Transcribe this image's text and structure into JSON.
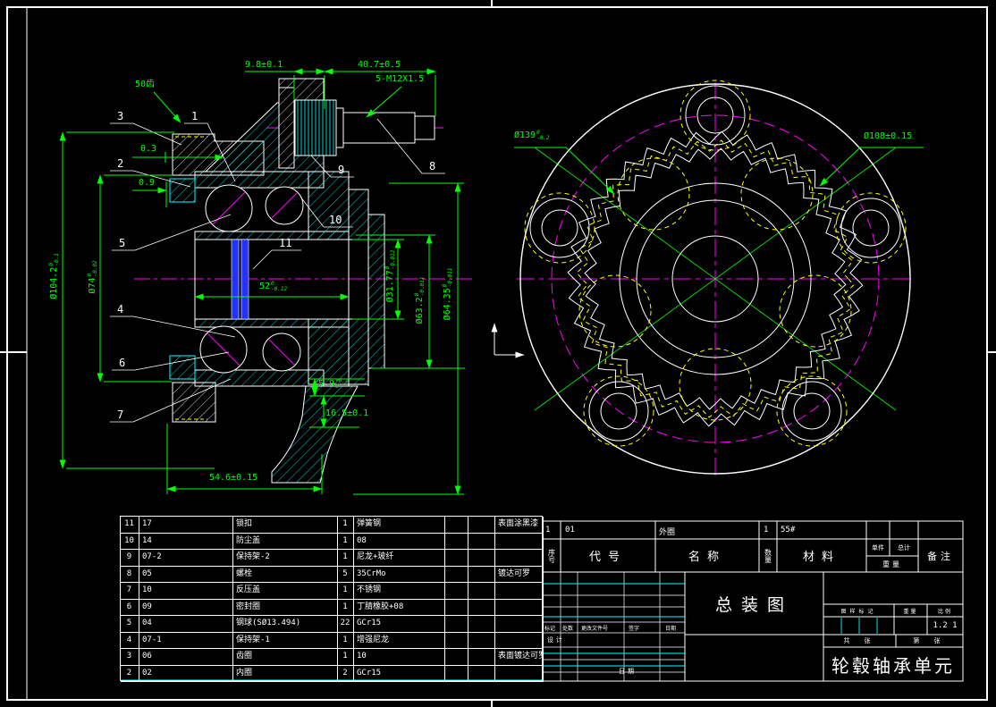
{
  "left_view": {
    "teeth_label": "50齿",
    "balloons": [
      "1",
      "2",
      "3",
      "4",
      "5",
      "6",
      "7",
      "8",
      "9",
      "10",
      "11"
    ],
    "dims": {
      "top_a": {
        "main": "9.8±0.1"
      },
      "top_b": {
        "main": "40.7±0.5"
      },
      "thread": {
        "main": "5-M12X1.5"
      },
      "edge_a": {
        "main": "0.3"
      },
      "edge_b": {
        "main": "0.9"
      },
      "od": {
        "main": "Ø104.2",
        "up": "0",
        "low": "-0.1"
      },
      "pilot": {
        "main": "Ø74",
        "up": "0",
        "low": "-0.02"
      },
      "width": {
        "main": "52",
        "up": "0",
        "low": "-0.12"
      },
      "bore": {
        "main": "Ø31.77",
        "up": "0",
        "low": "-0.012"
      },
      "race_a": {
        "main": "Ø63.2",
        "up": "0",
        "low": "-0.011"
      },
      "race_b": {
        "main": "Ø64.35",
        "up": "0",
        "low": "-0.011"
      },
      "step": {
        "main": "5.9",
        "up": "+0.1",
        "low": "0"
      },
      "depth": {
        "main": "16.5±0.1"
      },
      "length": {
        "main": "54.6±0.15"
      }
    }
  },
  "right_view": {
    "dims": {
      "flange": {
        "main": "Ø139",
        "up": "0",
        "low": "-0.2"
      },
      "bolt_circle": {
        "main": "Ø108±0.15"
      }
    }
  },
  "bom": {
    "header": {
      "seq": "序号",
      "code": "代号",
      "name": "名称",
      "qty": "数量",
      "material": "材料",
      "unit": "单件",
      "total": "总计",
      "weight": "重量",
      "remark": "备注"
    },
    "row1": {
      "seq": "1",
      "code": "01",
      "name": "外圈",
      "qty": "1",
      "material": "55#"
    },
    "rows": [
      {
        "seq": "11",
        "code": "17",
        "name": "锁扣",
        "qty": "1",
        "material": "弹簧钢",
        "remark": "表面涂黑漆"
      },
      {
        "seq": "10",
        "code": "14",
        "name": "防尘盖",
        "qty": "1",
        "material": "08",
        "remark": ""
      },
      {
        "seq": "9",
        "code": "07-2",
        "name": "保持架-2",
        "qty": "1",
        "material": "尼龙+玻纤",
        "remark": ""
      },
      {
        "seq": "8",
        "code": "05",
        "name": "螺栓",
        "qty": "5",
        "material": "35CrMo",
        "remark": "镀达可罗"
      },
      {
        "seq": "7",
        "code": "10",
        "name": "反压盖",
        "qty": "1",
        "material": "不锈钢",
        "remark": ""
      },
      {
        "seq": "6",
        "code": "09",
        "name": "密封圈",
        "qty": "1",
        "material": "丁腈橡胶+08",
        "remark": ""
      },
      {
        "seq": "5",
        "code": "04",
        "name": "钢球(SØ13.494)",
        "qty": "22",
        "material": "GCr15",
        "remark": ""
      },
      {
        "seq": "4",
        "code": "07-1",
        "name": "保持架-1",
        "qty": "1",
        "material": "增强尼龙",
        "remark": ""
      },
      {
        "seq": "3",
        "code": "06",
        "name": "齿圈",
        "qty": "1",
        "material": "10",
        "remark": "表面镀达可罗"
      },
      {
        "seq": "2",
        "code": "02",
        "name": "内圈",
        "qty": "2",
        "material": "GCr15",
        "remark": ""
      }
    ]
  },
  "title_block": {
    "drawing_title": "总装图",
    "part_title": "轮毂轴承单元",
    "revision_header": [
      "标记",
      "处数",
      "更改文件号",
      "签字",
      "日期"
    ],
    "design_label": "设计",
    "date_label": "日期",
    "stamp": {
      "mark": "图样标记",
      "weight": "重量",
      "scale": "比例",
      "scale_value": "1.2 1",
      "sheets": "共 张",
      "sheet": "第 张"
    }
  },
  "colors": {
    "dimension": "#00ff00",
    "centerline": "#ff00ff",
    "hatch_alt": "#00ffff",
    "hidden": "#ffff00",
    "encoder": "#2233ff",
    "line": "#ffffff"
  }
}
